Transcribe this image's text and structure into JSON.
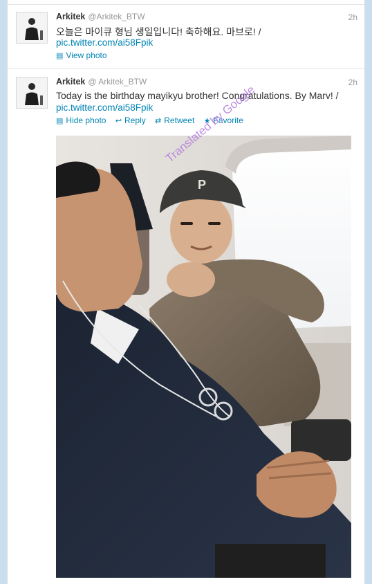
{
  "tweets": [
    {
      "name": "Arkitek",
      "handle": "@Arkitek_BTW",
      "time": "2h",
      "text": "오늘은 마이큐 형님 생일입니다! 축하해요. 마브로! /",
      "link": "pic.twitter.com/ai58Fpik",
      "actions": [
        {
          "label": "View photo",
          "icon": "photo-icon"
        }
      ]
    },
    {
      "name": "Arkitek",
      "handle": "@ Arkitek_BTW",
      "time": "2h",
      "text": "Today is the birthday mayikyu brother! Congratulations. By Marv! /",
      "link": "pic.twitter.com/ai58Fpik",
      "actions": [
        {
          "label": "Hide photo",
          "icon": "photo-icon"
        },
        {
          "label": "Reply",
          "icon": "reply-icon"
        },
        {
          "label": "Retweet",
          "icon": "retweet-icon"
        },
        {
          "label": "Favorite",
          "icon": "star-icon"
        }
      ]
    }
  ],
  "watermark": "Translated by Google",
  "colors": {
    "link": "#0084b4",
    "muted": "#999999",
    "text": "#333333",
    "watermark": "#b27ae0",
    "page_bg": "#c9dfee"
  }
}
